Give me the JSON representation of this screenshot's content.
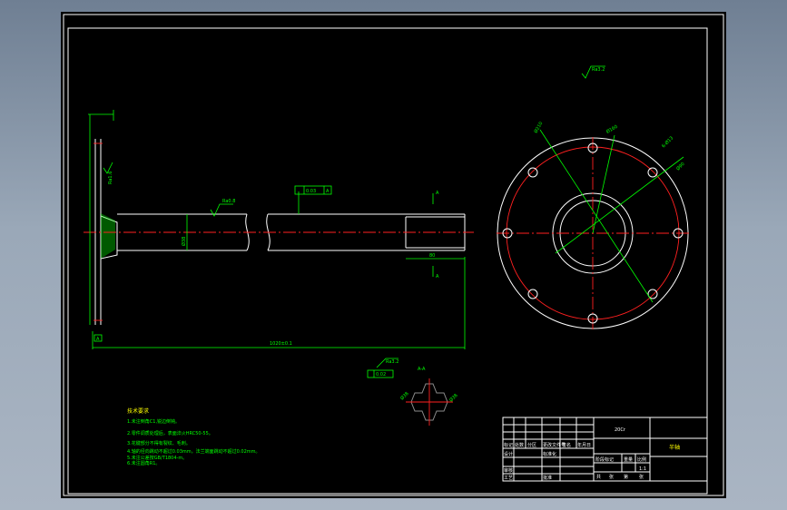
{
  "drawing": {
    "title": "半轴",
    "material": "20Cr",
    "scale": "1:1",
    "surface_finish_default": "Ra3.2",
    "shaft_length_dimension": "1020±0.1",
    "shaft_diameter_dimension": "Ø38",
    "flange_roughness": "Ra1.6",
    "shaft_roughness": "Ra0.8",
    "runout_tolerance": "0.03",
    "runout_datum": "A",
    "datum_label": "A",
    "section_label": "A-A",
    "spline_length": "80",
    "bolt_holes": "6-Ø13",
    "bolt_circle": "Ø160",
    "flange_diameter": "Ø210",
    "hub_diameter": "Ø90",
    "section_tolerance": "0.02",
    "section_roughness": "Ra3.2",
    "spline_dim": "Ø38"
  },
  "tech_requirements": {
    "heading": "技术要求",
    "lines": [
      "1.未注倒角C1,锐边倒钝。",
      "2.零件调质处理后，表面淬火HRC50-55。",
      "3.花键部分不得有裂纹、毛刺。",
      "4.轴的径向跳动不超过0.03mm，法兰端面跳动不超过0.02mm。",
      "5.未注公差按GB/T1804-m。",
      "6.未注圆角R1。"
    ]
  },
  "title_block": {
    "material_cell": "20Cr",
    "name_cell": "半轴",
    "row_labels": [
      "标记",
      "处数",
      "分区",
      "更改文件号",
      "签名",
      "年月日"
    ],
    "design_row": [
      "设计",
      "",
      "标准化"
    ],
    "review_row": [
      "审核",
      "",
      ""
    ],
    "process_row": [
      "工艺",
      "",
      "批准"
    ],
    "stage_headers": [
      "阶段标记",
      "重量",
      "比例"
    ],
    "scale_value": "1:1",
    "sheet_row": [
      "共",
      "张",
      "第",
      "张"
    ]
  },
  "colors": {
    "background": "#000000",
    "outline": "#ffffff",
    "dimension": "#00ff00",
    "centerline": "#ff2020",
    "annotation": "#ffff00"
  }
}
